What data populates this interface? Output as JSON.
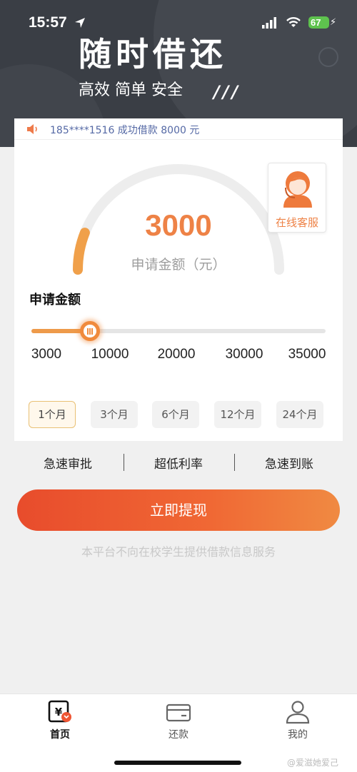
{
  "status_bar": {
    "time": "15:57",
    "battery": "67"
  },
  "hero": {
    "title": "随时借还",
    "subtitle": "高效 简单 安全",
    "slashes": "///"
  },
  "notice": {
    "text": "185****1516 成功借款 8000 元"
  },
  "loan": {
    "amount": "3000",
    "amount_label": "申请金额（元）",
    "gauge_fraction": 0.12,
    "customer_service_label": "在线客服",
    "slider_title": "申请金额",
    "slider_value_fraction": 0.2,
    "slider_ticks": [
      "3000",
      "10000",
      "20000",
      "30000",
      "35000"
    ],
    "terms": [
      "1个月",
      "3个月",
      "6个月",
      "12个月",
      "24个月"
    ],
    "selected_term_index": 0
  },
  "features": [
    "急速审批",
    "超低利率",
    "急速到账"
  ],
  "cta_label": "立即提现",
  "disclaimer": "本平台不向在校学生提供借款信息服务",
  "tabs": [
    {
      "label": "首页",
      "icon": "home-yen-icon",
      "active": true
    },
    {
      "label": "还款",
      "icon": "card-icon",
      "active": false
    },
    {
      "label": "我的",
      "icon": "profile-icon",
      "active": false
    }
  ],
  "watermark": "@爱滋她爱己",
  "colors": {
    "accent": "#ee8246",
    "cta_start": "#e84c2c",
    "cta_end": "#f08a42",
    "hero_bg": "#3a3e45"
  }
}
